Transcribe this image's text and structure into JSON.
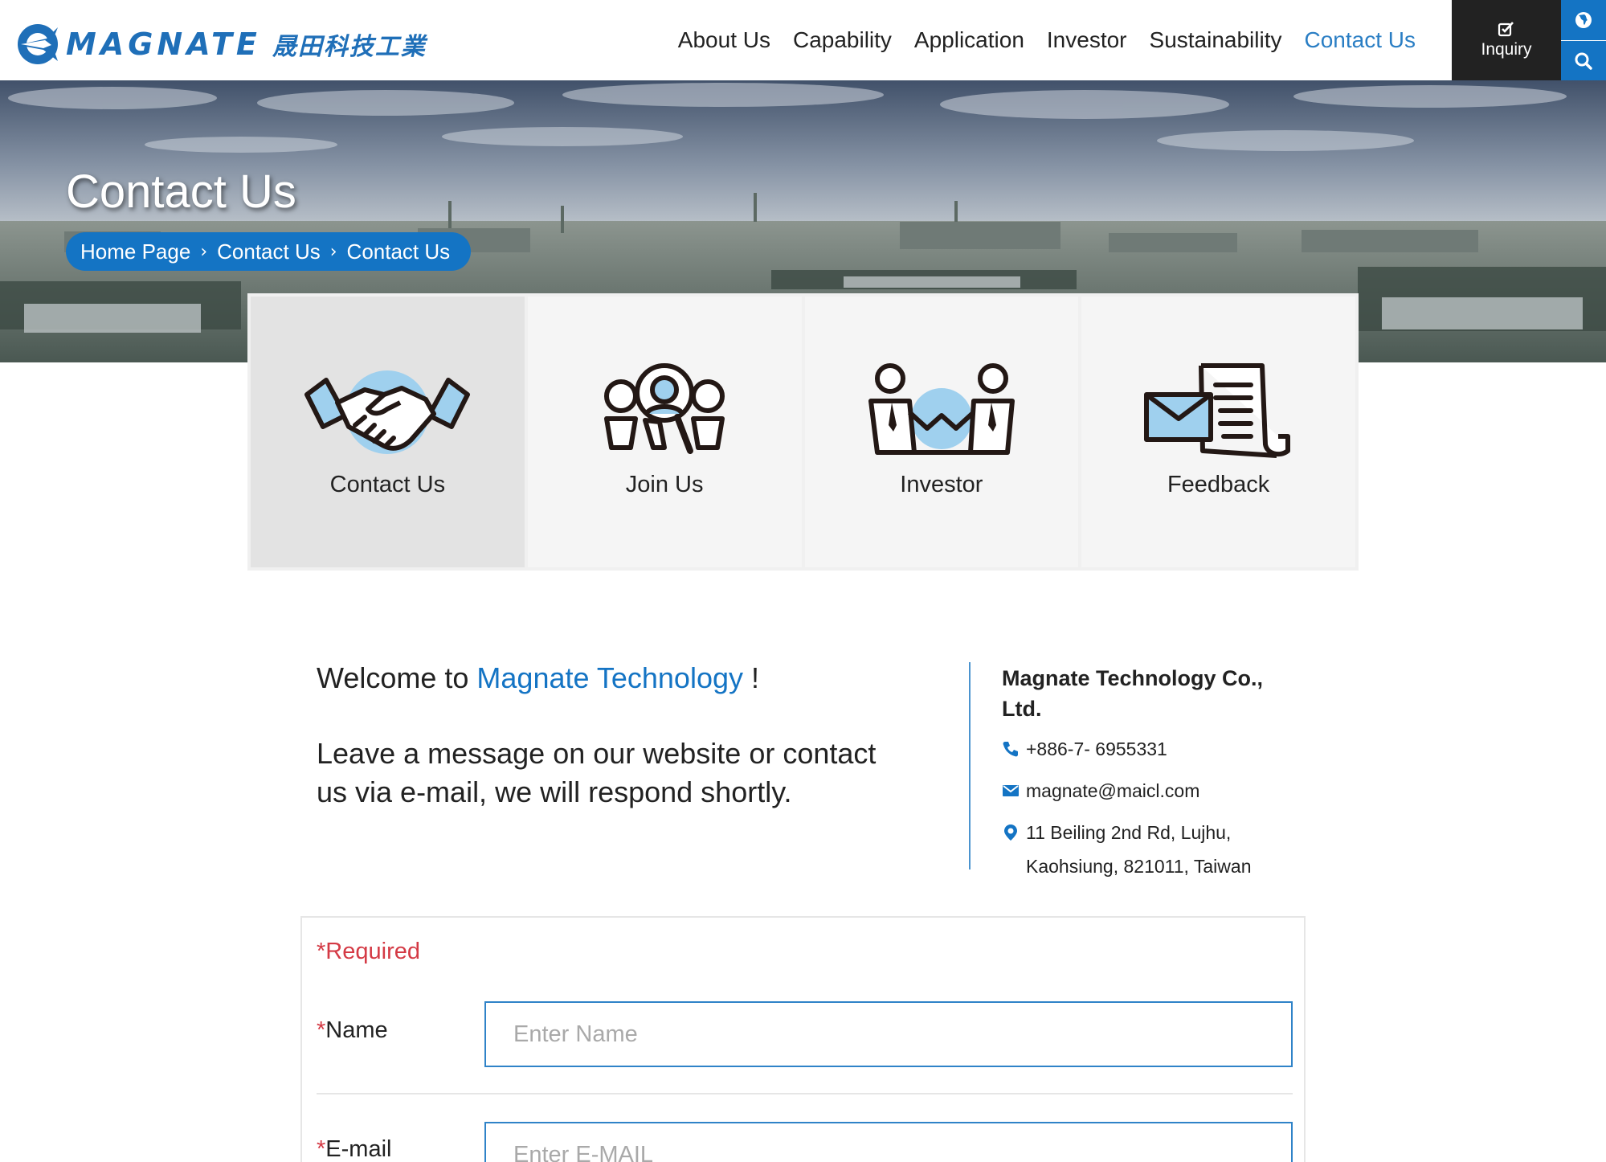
{
  "header": {
    "logo_text": "MAGNATE",
    "logo_cn": "晟田科技工業",
    "nav": [
      {
        "label": "About Us",
        "active": false
      },
      {
        "label": "Capability",
        "active": false
      },
      {
        "label": "Application",
        "active": false
      },
      {
        "label": "Investor",
        "active": false
      },
      {
        "label": "Sustainability",
        "active": false
      },
      {
        "label": "Contact Us",
        "active": true
      }
    ],
    "inquiry_label": "Inquiry",
    "icons": {
      "inquiry": "checkbox-edit-icon",
      "language": "globe-icon",
      "search": "search-icon"
    }
  },
  "hero": {
    "title": "Contact Us",
    "breadcrumb": [
      "Home Page",
      "Contact Us",
      "Contact Us"
    ]
  },
  "cards": [
    {
      "label": "Contact Us",
      "icon": "handshake-icon",
      "selected": true
    },
    {
      "label": "Join Us",
      "icon": "recruit-magnifier-icon",
      "selected": false
    },
    {
      "label": "Investor",
      "icon": "investor-chart-icon",
      "selected": false
    },
    {
      "label": "Feedback",
      "icon": "feedback-letter-icon",
      "selected": false
    }
  ],
  "welcome": {
    "prefix": "Welcome to",
    "brand": "Magnate Technology",
    "suffix": "!",
    "message": "Leave a message on our website or contact us via e-mail, we will respond shortly."
  },
  "company": {
    "name": "Magnate Technology Co., Ltd.",
    "phone": "+886-7- 6955331",
    "email": "magnate@maicl.com",
    "address_line1": "11 Beiling 2nd Rd, Lujhu,",
    "address_line2": "Kaohsiung, 821011, Taiwan"
  },
  "form": {
    "required_note": "Required",
    "fields": [
      {
        "label": "Name",
        "placeholder": "Enter Name",
        "value": ""
      },
      {
        "label": "E-mail",
        "placeholder": "Enter E-MAIL",
        "value": ""
      }
    ]
  },
  "colors": {
    "brand_blue": "#1474c4",
    "accent_light_blue": "#9fd0ee",
    "required_red": "#d43a45",
    "dark": "#222222"
  }
}
